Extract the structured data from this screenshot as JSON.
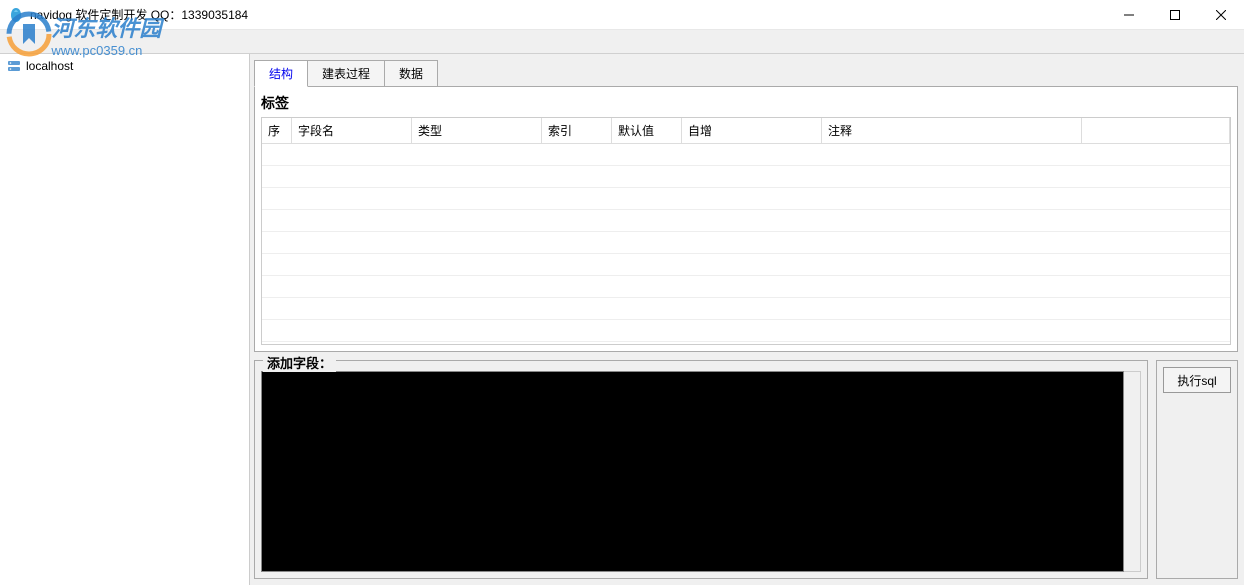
{
  "window": {
    "title": "navidog    软件定制开发  QQ：1339035184"
  },
  "watermark": {
    "text": "河东软件园",
    "url": "www.pc0359.cn"
  },
  "toolbar": {
    "label": ""
  },
  "sidebar": {
    "items": [
      {
        "label": "localhost"
      }
    ]
  },
  "tabs": [
    {
      "label": "结构",
      "active": true
    },
    {
      "label": "建表过程",
      "active": false
    },
    {
      "label": "数据",
      "active": false
    }
  ],
  "structure": {
    "section_label": "标签",
    "columns": {
      "seq": "序",
      "field_name": "字段名",
      "type": "类型",
      "index": "索引",
      "default": "默认值",
      "autoinc": "自增",
      "comment": "注释"
    },
    "rows": []
  },
  "bottom": {
    "fieldset_label": "添加字段：",
    "sql_value": "",
    "exec_label": "执行sql"
  }
}
